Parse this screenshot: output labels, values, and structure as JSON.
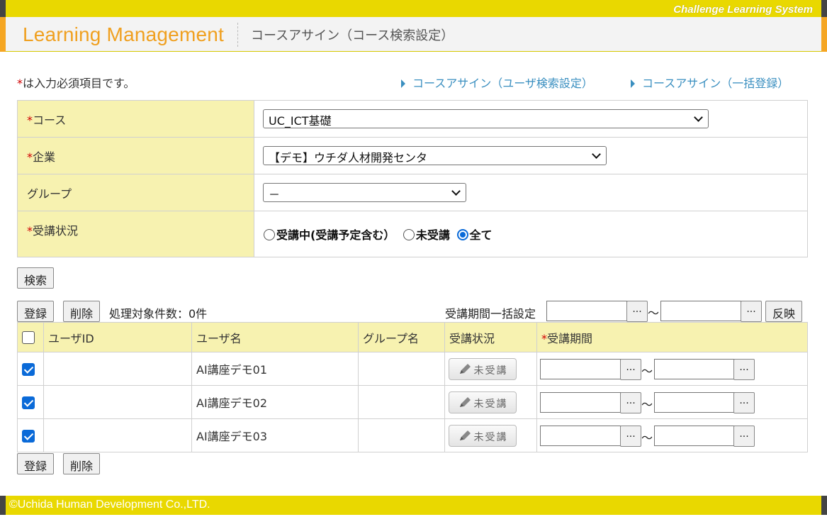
{
  "system_name": "Challenge Learning System",
  "logo_text": "Learning Management",
  "page_title": "コースアサイン（コース検索設定）",
  "required_note": "は入力必須項目です。",
  "required_mark": "*",
  "links": [
    "コースアサイン（ユーザ検索設定）",
    "コースアサイン（一括登録）"
  ],
  "form": {
    "course_label": "コース",
    "course_value": "UC_ICT基礎",
    "company_label": "企業",
    "company_value": "【デモ】ウチダ人材開発センタ",
    "group_label": "グループ",
    "group_value": "－",
    "status_label": "受講状況",
    "status_options": [
      "受講中(受講予定含む）",
      "未受講",
      "全て"
    ],
    "status_selected": "全て"
  },
  "buttons": {
    "search": "検索",
    "register": "登録",
    "delete": "削除",
    "ellipsis": "...",
    "apply": "反映"
  },
  "count_text": "処理対象件数：0件",
  "period_bulk_label": "受講期間一括設定",
  "tilde": "～",
  "list": {
    "headers": [
      "ユーザID",
      "ユーザ名",
      "グループ名",
      "受講状況",
      "受講期間"
    ],
    "rows": [
      {
        "checked": true,
        "user_id": "",
        "user_name": "AI講座デモ01",
        "group": "",
        "status": "未受講"
      },
      {
        "checked": true,
        "user_id": "",
        "user_name": "AI講座デモ02",
        "group": "",
        "status": "未受講"
      },
      {
        "checked": true,
        "user_id": "",
        "user_name": "AI講座デモ03",
        "group": "",
        "status": "未受講"
      }
    ]
  },
  "footer": "©Uchida Human Development Co.,LTD.",
  "colors": {
    "brand_yellow": "#e9d800",
    "logo_orange": "#f0a020",
    "label_bg": "#f7f2b0",
    "link_blue": "#3a8fc0",
    "required_red": "#d00000"
  }
}
